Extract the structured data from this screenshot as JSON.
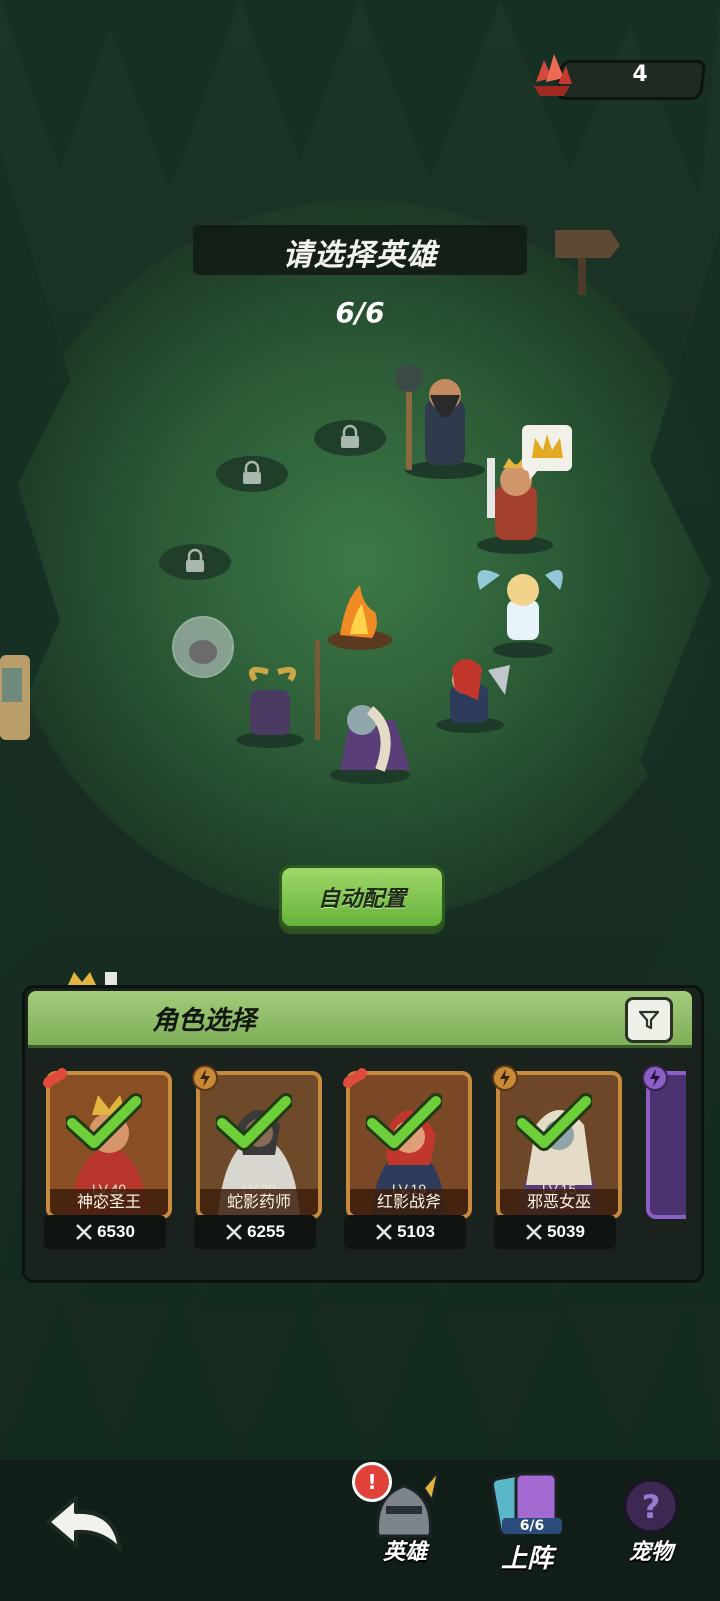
{
  "currency": {
    "icon": "red-crystal-icon",
    "value": "4"
  },
  "title": "请选择英雄",
  "selection_count": "6/6",
  "auto_button": "自动配置",
  "panel": {
    "title": "角色选择",
    "filter_icon": "filter-icon",
    "cards": [
      {
        "name": "神宓圣王",
        "level": "LV.40",
        "power": "6530",
        "badge": "strength-badge",
        "selected": true
      },
      {
        "name": "蛇影药师",
        "level": "LV.29",
        "power": "6255",
        "badge": "energy-badge",
        "selected": true
      },
      {
        "name": "红影战斧",
        "level": "LV.19",
        "power": "5103",
        "badge": "strength-badge",
        "selected": true
      },
      {
        "name": "邪恶女巫",
        "level": "LV.15",
        "power": "5039",
        "badge": "energy-badge",
        "selected": true
      }
    ]
  },
  "nav": {
    "back_icon": "back-arrow-icon",
    "heroes_label": "英雄",
    "heroes_alert": "!",
    "deploy_label": "上阵",
    "deploy_count": "6/6",
    "pets_label": "宠物"
  },
  "colors": {
    "accent_green": "#7fae58",
    "card_gold": "#c88a3c",
    "check_green": "#6fcf3a"
  }
}
